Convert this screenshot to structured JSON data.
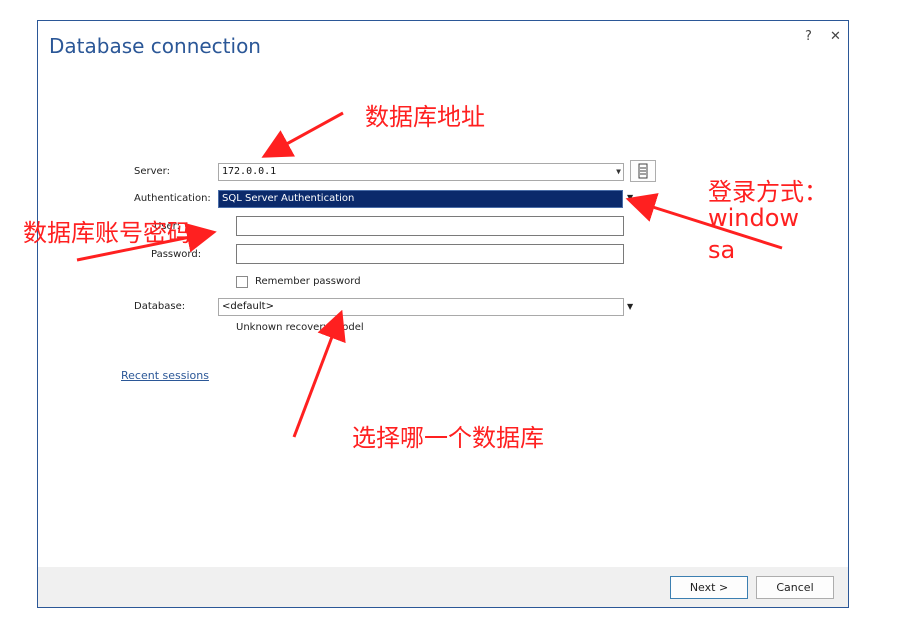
{
  "dialog": {
    "title": "Database connection",
    "help_label": "?",
    "close_label": "✕"
  },
  "form": {
    "server_label": "Server:",
    "server_value": "172.0.0.1",
    "auth_label": "Authentication:",
    "auth_value": "SQL Server Authentication",
    "user_label": "User:",
    "user_value": "",
    "password_label": "Password:",
    "password_value": "",
    "remember_label": "Remember password",
    "remember_checked": false,
    "database_label": "Database:",
    "database_value": "<default>",
    "recovery_note": "Unknown recovery model",
    "recent_sessions": "Recent sessions"
  },
  "footer": {
    "next_label": "Next >",
    "cancel_label": "Cancel"
  },
  "annotations": {
    "server_note": "数据库地址",
    "auth_note_line1": "登录方式：",
    "auth_note_line2": "window",
    "auth_note_line3": "sa",
    "account_note": "数据库账号密码",
    "database_note": "选择哪一个数据库",
    "color": "#ff2020"
  }
}
